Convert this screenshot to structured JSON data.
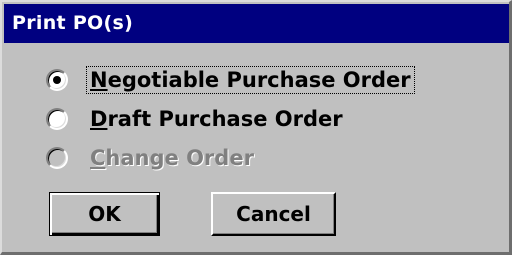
{
  "window": {
    "title": "Print PO(s)"
  },
  "options": [
    {
      "label_first": "N",
      "label_rest": "egotiable Purchase Order",
      "selected": true,
      "enabled": true
    },
    {
      "label_first": "D",
      "label_rest": "raft Purchase Order",
      "selected": false,
      "enabled": true
    },
    {
      "label_first": "C",
      "label_rest": "hange Order",
      "selected": false,
      "enabled": false
    }
  ],
  "buttons": {
    "ok_label": "OK",
    "cancel_label": "Cancel"
  },
  "colors": {
    "titlebar": "#000080",
    "dialog_face": "#c0c0c0",
    "disabled_text": "#808080"
  }
}
